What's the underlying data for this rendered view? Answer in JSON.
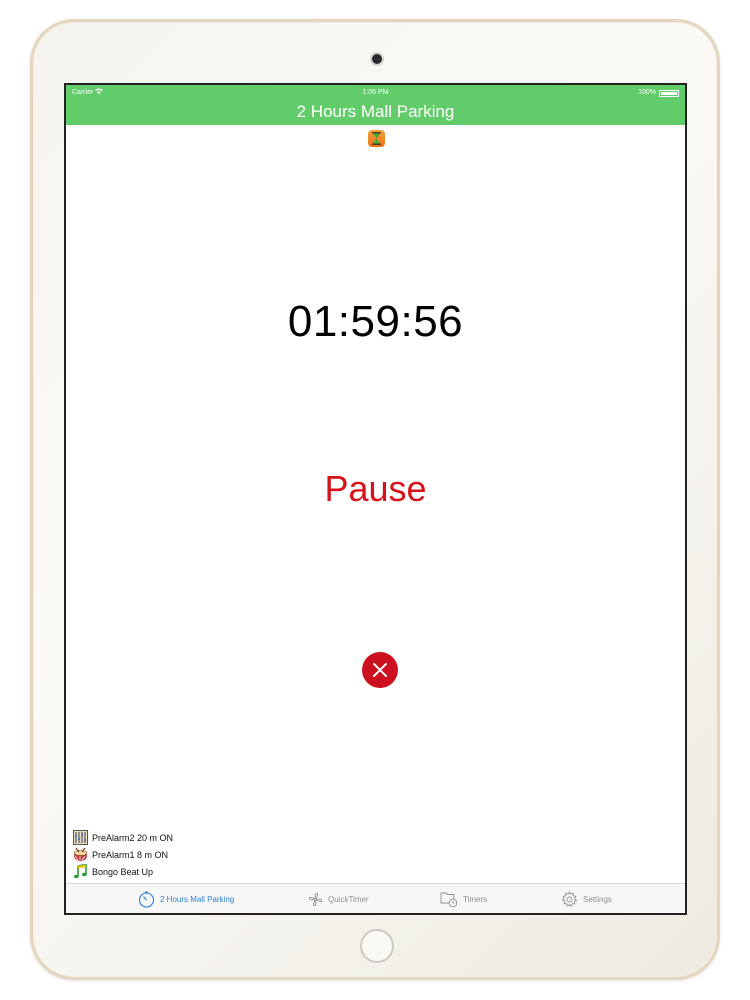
{
  "status_bar": {
    "carrier": "Carrier",
    "time": "1:06 PM",
    "battery": "100%"
  },
  "nav": {
    "title": "2 Hours Mall Parking"
  },
  "timer": {
    "display": "01:59:56"
  },
  "controls": {
    "pause_label": "Pause"
  },
  "alarms": [
    {
      "label": "PreAlarm2 20 m ON",
      "icon": "prealarm2-icon"
    },
    {
      "label": "PreAlarm1 8 m ON",
      "icon": "prealarm1-icon"
    },
    {
      "label": "Bongo Beat Up",
      "icon": "music-note-icon"
    }
  ],
  "tabs": [
    {
      "label": "2 Hours Mall Parking",
      "icon": "stopwatch-icon",
      "active": true
    },
    {
      "label": "QuickTimer",
      "icon": "fan-icon",
      "active": false
    },
    {
      "label": "Timers",
      "icon": "folder-clock-icon",
      "active": false
    },
    {
      "label": "Settings",
      "icon": "gear-icon",
      "active": false
    }
  ],
  "colors": {
    "accent_green": "#63cc6a",
    "pause_red": "#d8121b",
    "cancel_red": "#cc1020",
    "active_tab_blue": "#2f7fd4",
    "inactive_tab_gray": "#8e8e93"
  }
}
